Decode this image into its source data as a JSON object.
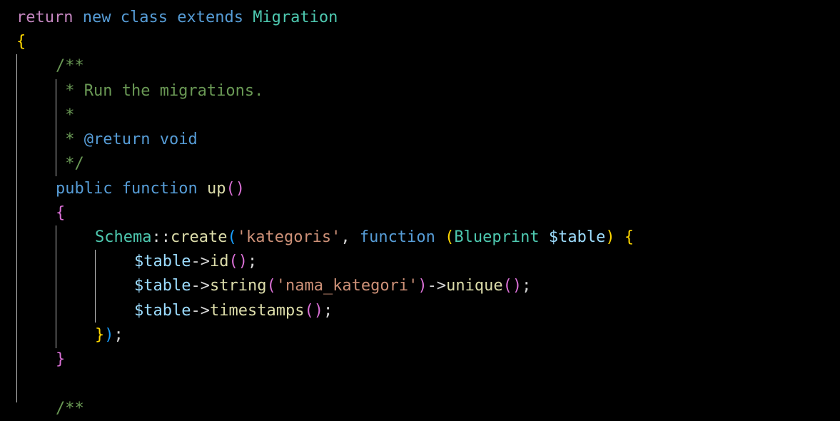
{
  "code": {
    "language": "php",
    "colors": {
      "background": "#000000",
      "keyword": "#569cd6",
      "control_keyword": "#c586c0",
      "class_name": "#4ec9b0",
      "function_name": "#dcdcaa",
      "string": "#ce9178",
      "variable": "#9cdcfe",
      "comment": "#6a9955",
      "bracket_level_1": "#ffd700",
      "bracket_level_2": "#da70d6",
      "bracket_level_3": "#179fff",
      "indent_guide": "#bdbdbd"
    },
    "tokens": {
      "return": "return",
      "new": "new",
      "class": "class",
      "extends": "extends",
      "migration": "Migration",
      "brace_open": "{",
      "brace_close": "}",
      "doc_open": "/**",
      "doc_run": " * Run the migrations.",
      "doc_star": " *",
      "doc_star_prefix": " * ",
      "doc_return_tag": "@return",
      "doc_void": " void",
      "doc_close": " */",
      "public": "public",
      "function": "function",
      "up": "up",
      "paren_open": "(",
      "paren_close": ")",
      "schema": "Schema",
      "double_colon": "::",
      "create": "create",
      "kategoris": "'kategoris'",
      "comma": ", ",
      "blueprint": "Blueprint",
      "table_var": "$table",
      "arrow": "->",
      "id": "id",
      "semicolon": ";",
      "string_fn": "string",
      "nama_kategori": "'nama_kategori'",
      "unique": "unique",
      "timestamps": "timestamps",
      "space": " "
    }
  }
}
